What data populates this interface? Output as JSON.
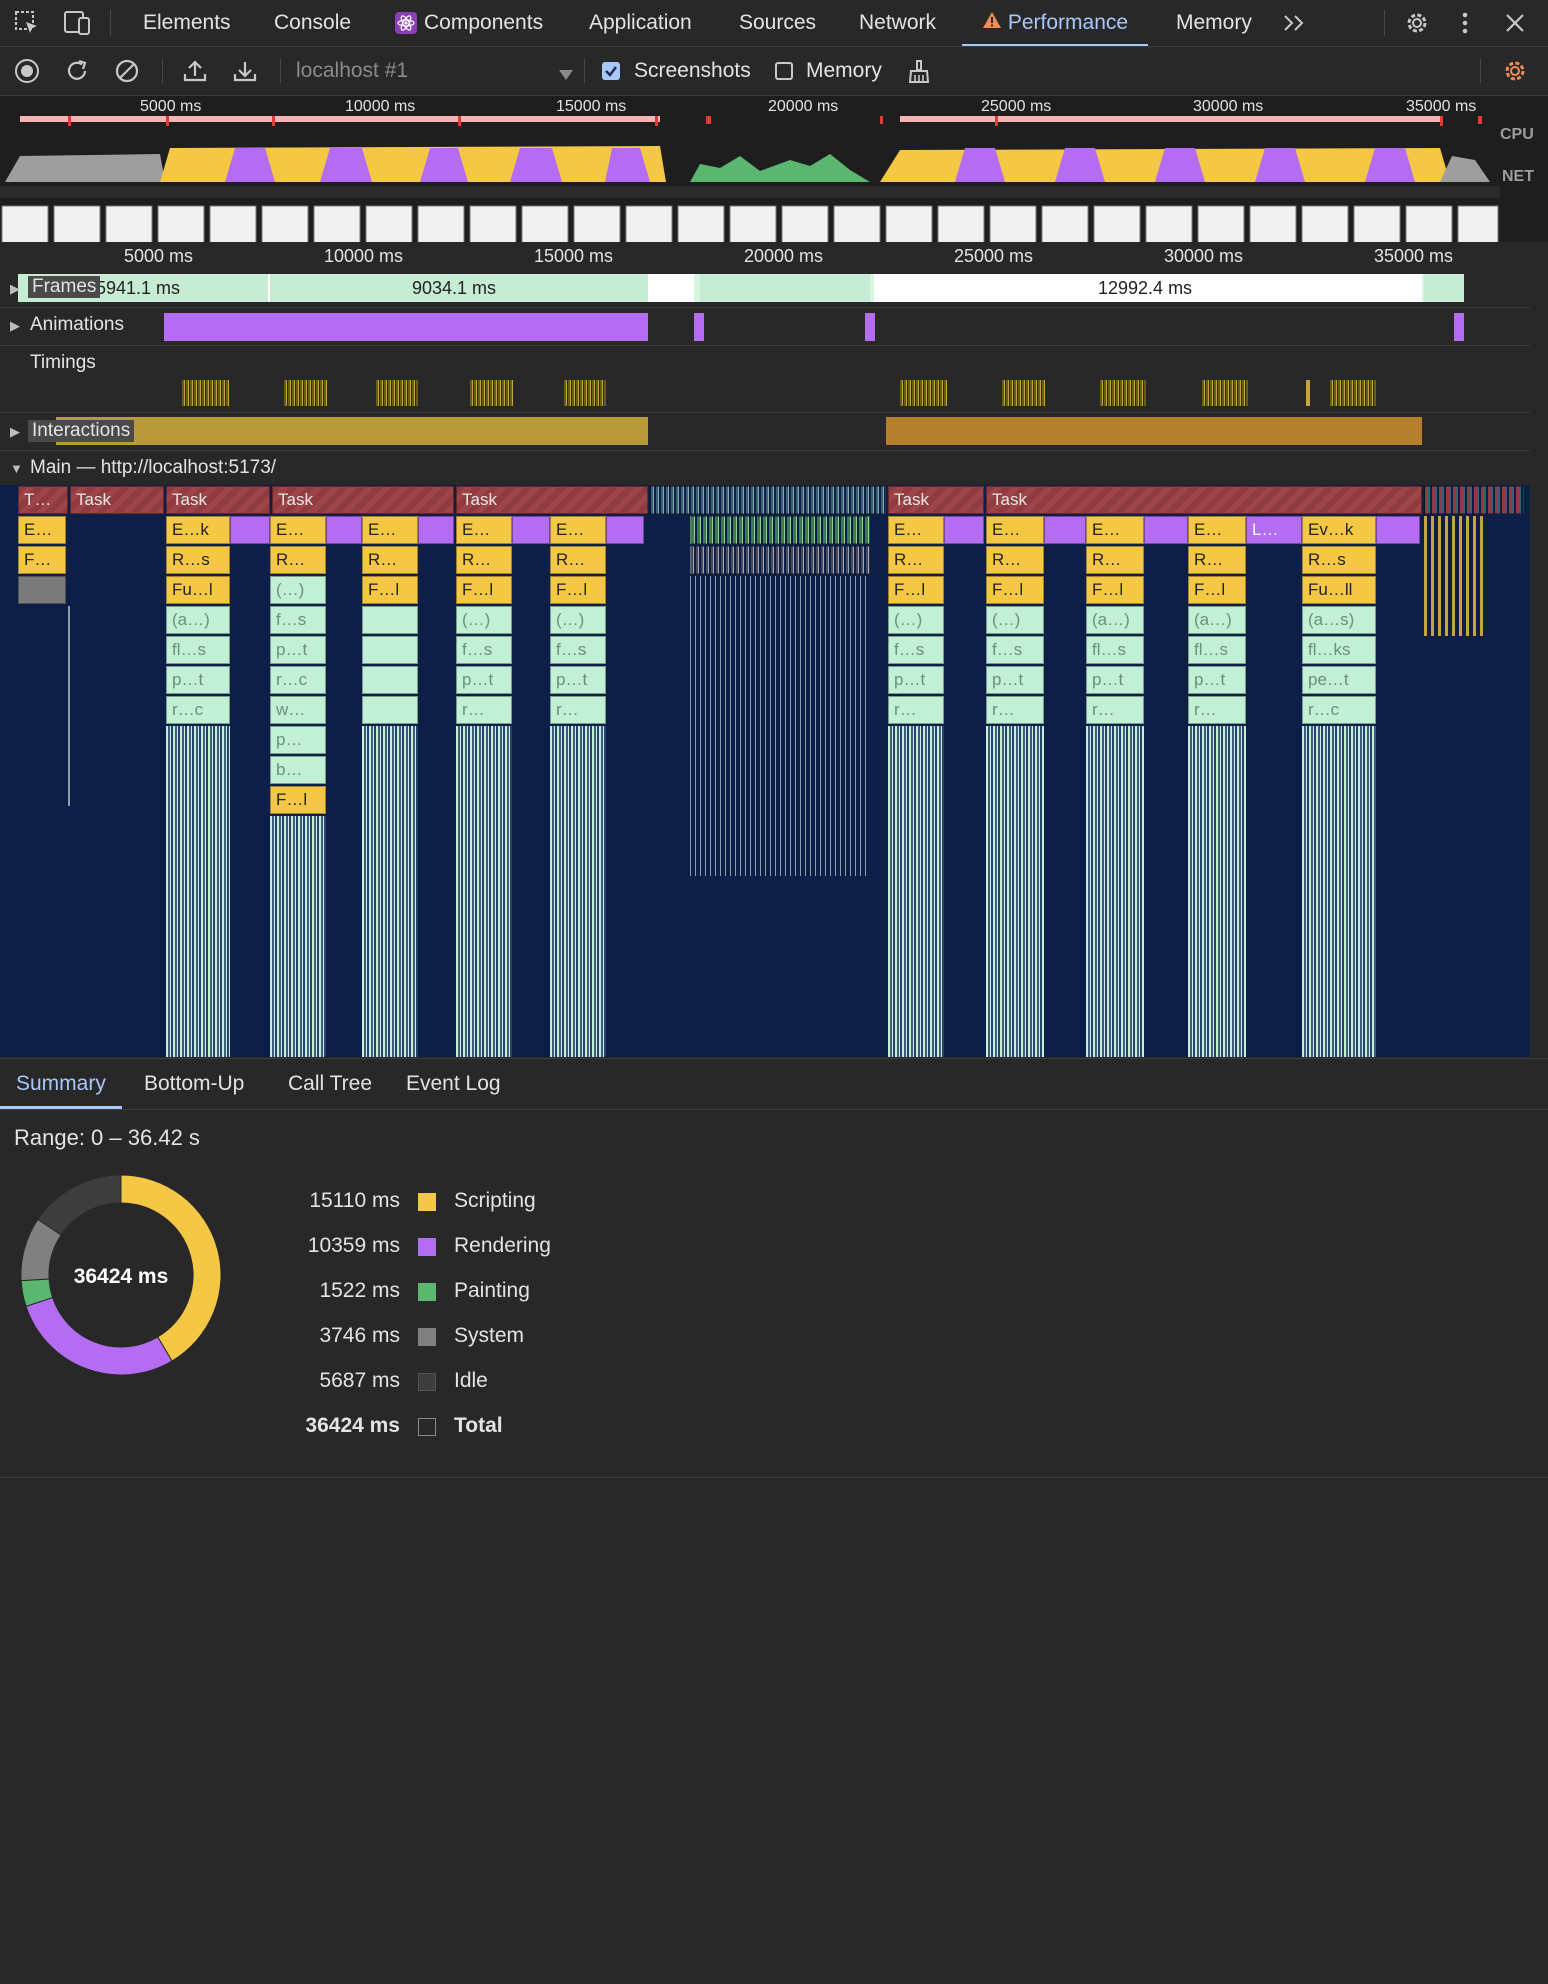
{
  "tabs": {
    "elements": "Elements",
    "console": "Console",
    "components": "Components",
    "application": "Application",
    "sources": "Sources",
    "network": "Network",
    "performance": "Performance",
    "memory": "Memory"
  },
  "toolbar": {
    "target": "localhost #1",
    "screenshots_label": "Screenshots",
    "screenshots_checked": true,
    "memory_label": "Memory",
    "memory_checked": false
  },
  "overview": {
    "ticks": [
      "5000 ms",
      "10000 ms",
      "15000 ms",
      "20000 ms",
      "25000 ms",
      "30000 ms",
      "35000 ms"
    ],
    "cpu_label": "CPU",
    "net_label": "NET"
  },
  "ruler": {
    "ticks": [
      "5000 ms",
      "10000 ms",
      "15000 ms",
      "20000 ms",
      "25000 ms",
      "30000 ms",
      "35000 ms"
    ]
  },
  "tracks": {
    "frames": "Frames",
    "frame_values": [
      "5941.1 ms",
      "9034.1 ms",
      "12992.4 ms"
    ],
    "animations": "Animations",
    "timings": "Timings",
    "interactions": "Interactions",
    "main": "Main — http://localhost:5173/"
  },
  "flame": {
    "task_labels": [
      "T…",
      "Task",
      "Task",
      "Task",
      "Task",
      "Task",
      "Task"
    ],
    "row1": [
      "E…",
      "E…k",
      "E…",
      "E…",
      "E…",
      "E…",
      "E…",
      "E…",
      "E…",
      "E…",
      "L…",
      "Ev…k"
    ],
    "row2": [
      "F…",
      "R…s",
      "R…",
      "R…",
      "R…",
      "R…",
      "R…",
      "R…",
      "R…",
      "R…",
      "R…s"
    ],
    "row3": [
      "Fu…l",
      "(…)",
      "F…l",
      "F…l",
      "F…l",
      "F…l",
      "F…l",
      "F…l",
      "F…l",
      "Fu…ll"
    ],
    "row4": [
      "(a…)",
      "f…s",
      "(…)",
      "(…)",
      "(…)",
      "(…)",
      "(a…)",
      "(a…)",
      "(a…s)"
    ],
    "row5": [
      "fl…s",
      "p…t",
      "f…s",
      "f…s",
      "f…s",
      "f…s",
      "fl…s",
      "fl…s",
      "fl…ks"
    ],
    "row6": [
      "p…t",
      "r…c",
      "p…t",
      "p…t",
      "p…t",
      "p…t",
      "p…t",
      "p…t",
      "pe…t"
    ],
    "row7": [
      "r…c",
      "w…",
      "r…",
      "r…",
      "r…",
      "r…",
      "r…",
      "r…",
      "r…c"
    ],
    "row8": [
      "p…"
    ],
    "row9": [
      "b…"
    ],
    "row10": [
      "F…l"
    ]
  },
  "bottom_tabs": {
    "summary": "Summary",
    "bottom_up": "Bottom-Up",
    "call_tree": "Call Tree",
    "event_log": "Event Log"
  },
  "summary": {
    "range": "Range: 0 – 36.42 s",
    "donut_total": "36424 ms",
    "rows": [
      {
        "value": "15110 ms",
        "label": "Scripting",
        "color": "#f4c845",
        "ms": 15110
      },
      {
        "value": "10359 ms",
        "label": "Rendering",
        "color": "#b36cf2",
        "ms": 10359
      },
      {
        "value": "1522 ms",
        "label": "Painting",
        "color": "#5bb66f",
        "ms": 1522
      },
      {
        "value": "3746 ms",
        "label": "System",
        "color": "#808080",
        "ms": 3746
      },
      {
        "value": "5687 ms",
        "label": "Idle",
        "color": "#3d3d3d",
        "ms": 5687
      },
      {
        "value": "36424 ms",
        "label": "Total",
        "color": "#282828",
        "ms": 36424
      }
    ]
  },
  "colors": {
    "accent": "#a8c7fa",
    "scripting": "#f4c845",
    "rendering": "#b36cf2",
    "painting": "#5bb66f",
    "warning": "#f28b54"
  }
}
